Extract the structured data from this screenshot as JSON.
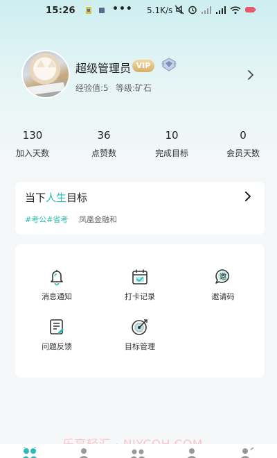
{
  "status_bar": {
    "time": "15:26",
    "dots": "•••",
    "speed": "5.1K/s"
  },
  "profile": {
    "username": "超级管理员",
    "vip_label": "VIP",
    "exp_text": "经验值:5",
    "level_text": "等级:矿石"
  },
  "stats": [
    {
      "value": "130",
      "label": "加入天数"
    },
    {
      "value": "36",
      "label": "点赞数"
    },
    {
      "value": "10",
      "label": "完成目标"
    },
    {
      "value": "0",
      "label": "会员天数"
    }
  ],
  "goal": {
    "title_prefix": "当下",
    "title_highlight": "人生",
    "title_suffix": "目标",
    "tags": "#考公#省考",
    "company": "凤凰金融和"
  },
  "menu": [
    {
      "label": "消息通知",
      "icon": "bell-icon"
    },
    {
      "label": "打卡记录",
      "icon": "calendar-check-icon"
    },
    {
      "label": "邀请码",
      "icon": "invite-bubble-icon",
      "glyph": "邀"
    },
    {
      "label": "问题反馈",
      "icon": "feedback-doc-icon"
    },
    {
      "label": "目标管理",
      "icon": "target-icon"
    }
  ],
  "watermark": "乐享轻汇 · NJYCQH.COM",
  "colors": {
    "accent": "#2bbcb3",
    "vip_gold": "#d7ae6b",
    "background": "#f6f7f9",
    "card": "#ffffff"
  }
}
